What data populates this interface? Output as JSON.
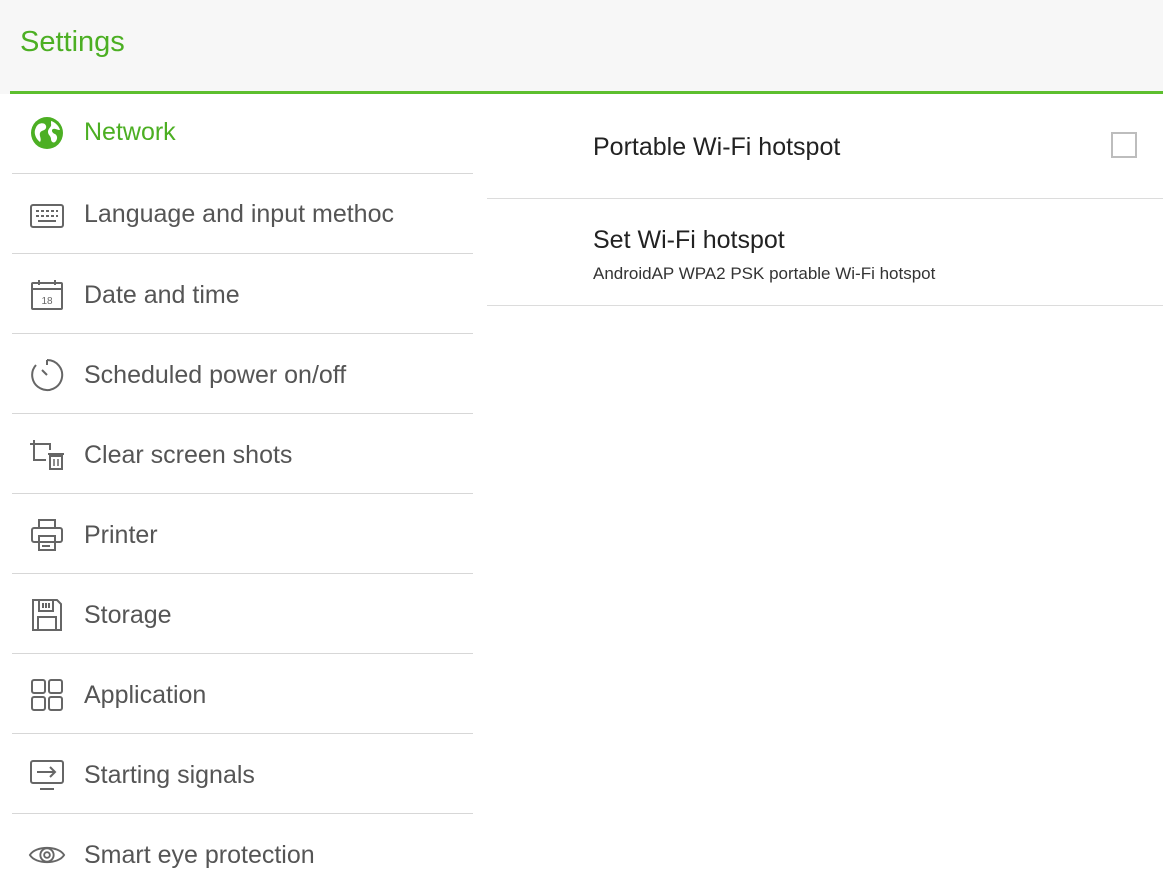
{
  "header": {
    "title": "Settings"
  },
  "sidebar": {
    "items": [
      {
        "label": "Network",
        "icon": "globe-icon",
        "active": true
      },
      {
        "label": "Language and input methoc",
        "icon": "keyboard-icon"
      },
      {
        "label": "Date and time",
        "icon": "calendar-icon",
        "icon_text": "18"
      },
      {
        "label": "Scheduled power on/off",
        "icon": "timer-icon"
      },
      {
        "label": "Clear screen shots",
        "icon": "screenshot-trash-icon"
      },
      {
        "label": "Printer",
        "icon": "printer-icon"
      },
      {
        "label": "Storage",
        "icon": "storage-icon"
      },
      {
        "label": "Application",
        "icon": "apps-grid-icon"
      },
      {
        "label": "Starting signals",
        "icon": "input-source-icon"
      },
      {
        "label": "Smart eye protection",
        "icon": "eye-icon"
      }
    ]
  },
  "content": {
    "hotspot_toggle": {
      "title": "Portable Wi-Fi hotspot",
      "checked": false
    },
    "set_hotspot": {
      "title": "Set Wi-Fi hotspot",
      "summary": "AndroidAP WPA2 PSK portable Wi-Fi hotspot"
    }
  },
  "colors": {
    "accent": "#4caf23",
    "divider": "#d7d7d7",
    "header_bg": "#f7f7f7"
  }
}
